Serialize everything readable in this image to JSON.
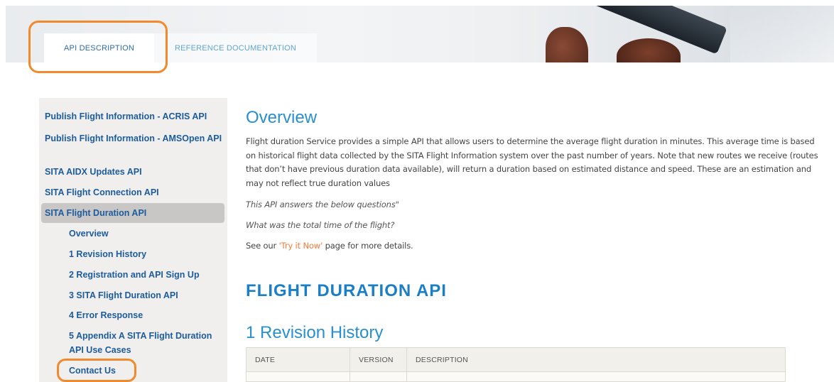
{
  "tabs": [
    {
      "label": "API DESCRIPTION",
      "active": true
    },
    {
      "label": "REFERENCE DOCUMENTATION",
      "active": false
    }
  ],
  "sidebar": {
    "items": [
      {
        "label": "Publish Flight Information - ACRIS API"
      },
      {
        "label": "Publish Flight Information - AMSOpen API"
      },
      {
        "label": "SITA AIDX Updates API"
      },
      {
        "label": "SITA Flight Connection API"
      },
      {
        "label": "SITA Flight Duration API",
        "active": true
      }
    ],
    "subitems": [
      {
        "label": "Overview"
      },
      {
        "label": "1 Revision History"
      },
      {
        "label": "2 Registration and API Sign Up"
      },
      {
        "label": "3 SITA Flight Duration API"
      },
      {
        "label": "4 Error Response"
      },
      {
        "label": "5 Appendix A SITA Flight Duration API Use Cases"
      },
      {
        "label": "Contact Us"
      }
    ]
  },
  "main": {
    "overview_title": "Overview",
    "intro": "Flight duration Service provides a simple API that allows users to determine the average flight duration in minutes. This average time is based on historical flight data collected by the SITA Flight Information system over the past number of years. Note that new routes we receive (routes that don’t have previous duration data available), will return a duration based on estimated distance and speed. These are an estimation and may not reflect true duration values",
    "questions_intro": "This API answers the below questions\"",
    "question_1": "What was the total time of the flight?",
    "see_prefix": "See our ",
    "try_link": "'Try it Now'",
    "see_suffix": " page for more details.",
    "api_title": "FLIGHT DURATION API",
    "revision_title": "1 Revision History",
    "table": {
      "headers": [
        "DATE",
        "VERSION",
        "DESCRIPTION"
      ]
    }
  },
  "colors": {
    "accent": "#2a8fce",
    "link": "#1d5c9c",
    "highlight": "#f08a2c",
    "try_link": "#ee7d3a"
  }
}
